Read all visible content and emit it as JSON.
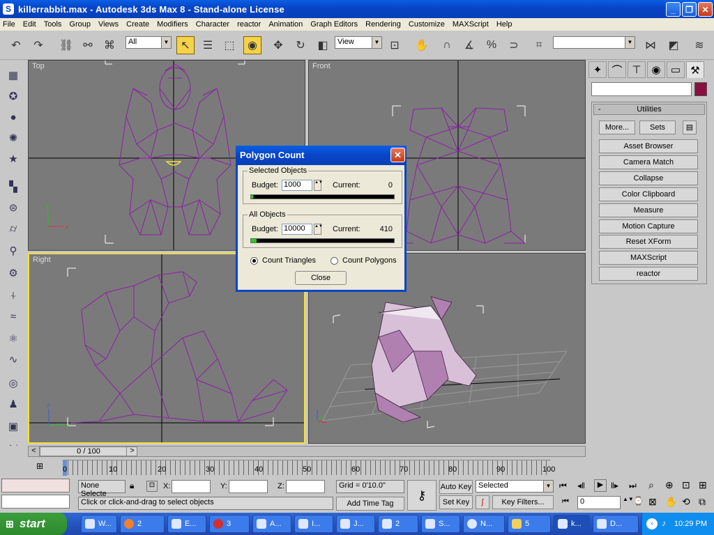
{
  "window": {
    "title": "killerrabbit.max - Autodesk 3ds Max 8 - Stand-alone License",
    "app_icon": "3ds-max-icon"
  },
  "menu": [
    "File",
    "Edit",
    "Tools",
    "Group",
    "Views",
    "Create",
    "Modifiers",
    "Character",
    "reactor",
    "Animation",
    "Graph Editors",
    "Rendering",
    "Customize",
    "MAXScript",
    "Help"
  ],
  "toolbar": {
    "selection_filter": "All",
    "ref_coord": "View",
    "named_selection": ""
  },
  "viewports": {
    "top": "Top",
    "front": "Front",
    "right": "Right",
    "perspective": ""
  },
  "command_panel": {
    "rollout_title": "Utilities",
    "more_label": "More...",
    "sets_label": "Sets",
    "utilities": [
      "Asset Browser",
      "Camera Match",
      "Collapse",
      "Color Clipboard",
      "Measure",
      "Motion Capture",
      "Reset XForm",
      "MAXScript",
      "reactor"
    ],
    "object_color": "#8a1040"
  },
  "dialog": {
    "title": "Polygon Count",
    "selected": {
      "label": "Selected Objects",
      "budget_label": "Budget:",
      "budget": "1000",
      "current_label": "Current:",
      "current": "0",
      "fill": 0.0
    },
    "all": {
      "label": "All Objects",
      "budget_label": "Budget:",
      "budget": "10000",
      "current_label": "Current:",
      "current": "410",
      "fill": 0.041
    },
    "count_triangles": "Count Triangles",
    "count_polygons": "Count Polygons",
    "close_label": "Close"
  },
  "timeline": {
    "slider_label": "0 / 100",
    "ticks": [
      "0",
      "10",
      "20",
      "30",
      "40",
      "50",
      "60",
      "70",
      "80",
      "90",
      "100"
    ]
  },
  "status": {
    "selection": "None Selecte",
    "x_label": "X:",
    "y_label": "Y:",
    "z_label": "Z:",
    "grid": "Grid = 0'10.0\"",
    "prompt": "Click or click-and-drag to select objects",
    "add_time_tag": "Add Time Tag",
    "auto_key": "Auto Key",
    "set_key": "Set Key",
    "key_mode": "Selected",
    "key_filters": "Key Filters...",
    "frame": "0"
  },
  "taskbar": {
    "start": "start",
    "items": [
      "W...",
      "2",
      "E...",
      "3",
      "A...",
      "I...",
      "J...",
      "2",
      "S...",
      "N...",
      "5",
      "k...",
      "D..."
    ],
    "clock": "10:29 PM"
  }
}
